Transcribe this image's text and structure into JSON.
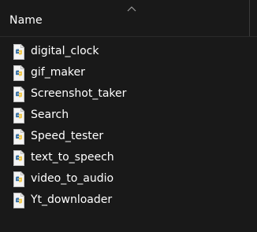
{
  "header": {
    "column_name": "Name",
    "sort_icon": "chevron-up-icon"
  },
  "files": [
    {
      "name": "digital_clock",
      "icon": "python-file-icon"
    },
    {
      "name": "gif_maker",
      "icon": "python-file-icon"
    },
    {
      "name": "Screenshot_taker",
      "icon": "python-file-icon"
    },
    {
      "name": "Search",
      "icon": "python-file-icon"
    },
    {
      "name": "Speed_tester",
      "icon": "python-file-icon"
    },
    {
      "name": "text_to_speech",
      "icon": "python-file-icon"
    },
    {
      "name": "video_to_audio",
      "icon": "python-file-icon"
    },
    {
      "name": "Yt_downloader",
      "icon": "python-file-icon"
    }
  ],
  "colors": {
    "background": "#191919",
    "text": "#ffffff",
    "python_blue": "#3a72a5",
    "python_yellow": "#f2c94c"
  }
}
